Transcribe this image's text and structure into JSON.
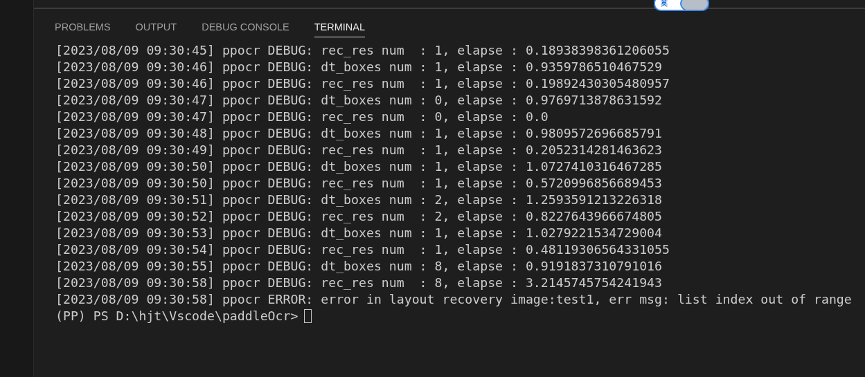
{
  "ime_toggle": {
    "label": "英"
  },
  "tabs": [
    {
      "label": "PROBLEMS",
      "selected": false
    },
    {
      "label": "OUTPUT",
      "selected": false
    },
    {
      "label": "DEBUG CONSOLE",
      "selected": false
    },
    {
      "label": "TERMINAL",
      "selected": true
    }
  ],
  "terminal": {
    "lines": [
      "[2023/08/09 09:30:45] ppocr DEBUG: rec_res num  : 1, elapse : 0.18938398361206055",
      "[2023/08/09 09:30:46] ppocr DEBUG: dt_boxes num : 1, elapse : 0.9359786510467529",
      "[2023/08/09 09:30:46] ppocr DEBUG: rec_res num  : 1, elapse : 0.19892430305480957",
      "[2023/08/09 09:30:47] ppocr DEBUG: dt_boxes num : 0, elapse : 0.9769713878631592",
      "[2023/08/09 09:30:47] ppocr DEBUG: rec_res num  : 0, elapse : 0.0",
      "[2023/08/09 09:30:48] ppocr DEBUG: dt_boxes num : 1, elapse : 0.9809572696685791",
      "[2023/08/09 09:30:49] ppocr DEBUG: rec_res num  : 1, elapse : 0.2052314281463623",
      "[2023/08/09 09:30:50] ppocr DEBUG: dt_boxes num : 1, elapse : 1.0727410316467285",
      "[2023/08/09 09:30:50] ppocr DEBUG: rec_res num  : 1, elapse : 0.5720996856689453",
      "[2023/08/09 09:30:51] ppocr DEBUG: dt_boxes num : 2, elapse : 1.2593591213226318",
      "[2023/08/09 09:30:52] ppocr DEBUG: rec_res num  : 2, elapse : 0.8227643966674805",
      "[2023/08/09 09:30:53] ppocr DEBUG: dt_boxes num : 1, elapse : 1.0279221534729004",
      "[2023/08/09 09:30:54] ppocr DEBUG: rec_res num  : 1, elapse : 0.48119306564331055",
      "[2023/08/09 09:30:55] ppocr DEBUG: dt_boxes num : 8, elapse : 0.9191837310791016",
      "[2023/08/09 09:30:58] ppocr DEBUG: rec_res num  : 8, elapse : 3.2145745754241943",
      "[2023/08/09 09:30:58] ppocr ERROR: error in layout recovery image:test1, err msg: list index out of range"
    ],
    "prompt": "(PP) PS D:\\hjt\\Vscode\\paddleOcr>"
  }
}
